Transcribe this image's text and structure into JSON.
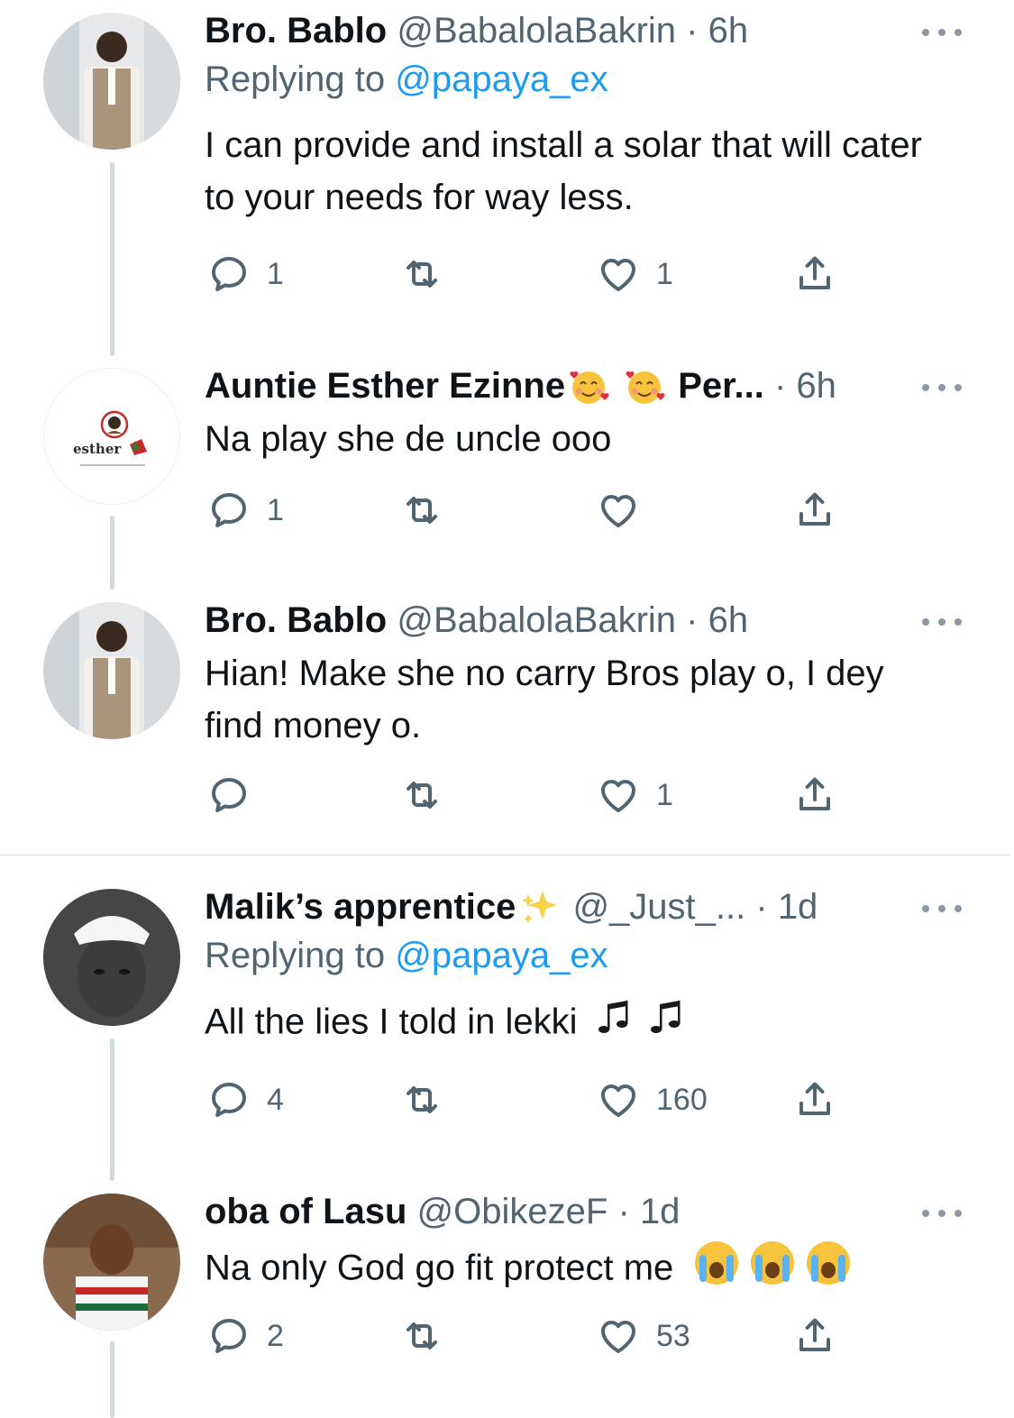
{
  "tweets": [
    {
      "name": "Bro. Bablo",
      "handle": "@BabalolaBakrin",
      "time": "6h",
      "replying_label": "Replying to",
      "replying_to": "@papaya_ex",
      "text": "I can provide and install a solar that will cater to your needs for way less.",
      "replies": "1",
      "retweets": "",
      "likes": "1"
    },
    {
      "name": "Auntie Esther Ezinne",
      "name_suffix": "Per...",
      "avatar_text": "esther",
      "time": "6h",
      "text": "Na play she de uncle ooo",
      "replies": "1",
      "retweets": "",
      "likes": ""
    },
    {
      "name": "Bro. Bablo",
      "handle": "@BabalolaBakrin",
      "time": "6h",
      "text": "Hian! Make she no carry Bros play o, I dey find money o.",
      "replies": "",
      "retweets": "",
      "likes": "1"
    },
    {
      "name": "Malik’s apprentice",
      "handle": "@_Just_...",
      "time": "1d",
      "replying_label": "Replying to",
      "replying_to": "@papaya_ex",
      "text": "All the lies I told in lekki",
      "replies": "4",
      "retweets": "",
      "likes": "160"
    },
    {
      "name": "oba of Lasu",
      "handle": "@ObikezeF",
      "time": "1d",
      "text": "Na only God go fit protect me",
      "replies": "2",
      "retweets": "",
      "likes": "53"
    }
  ],
  "separator": "·",
  "icons": {
    "reply": "reply-icon",
    "retweet": "retweet-icon",
    "like": "heart-icon",
    "share": "share-icon",
    "more": "more-options-icon"
  },
  "colors": {
    "text": "#0f1419",
    "secondary": "#536471",
    "link": "#1d9bf0",
    "thread_line": "#cfd9de"
  }
}
